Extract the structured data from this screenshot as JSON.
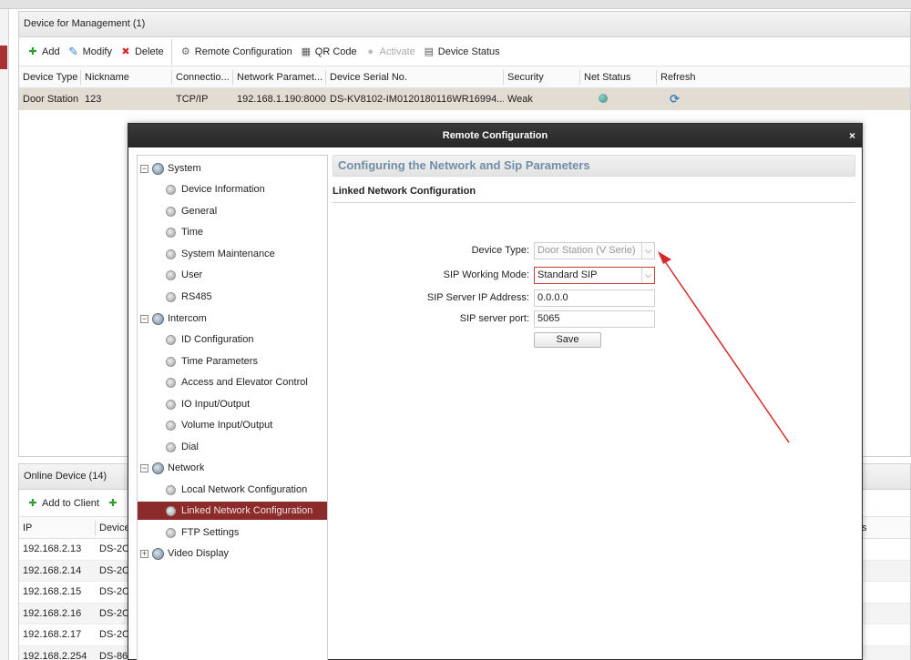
{
  "device_management": {
    "title": "Device for Management (1)",
    "toolbar": [
      {
        "label": "Add",
        "icon": "plus-icon"
      },
      {
        "label": "Modify",
        "icon": "edit-icon"
      },
      {
        "label": "Delete",
        "icon": "delete-icon"
      },
      {
        "label": "Remote Configuration",
        "icon": "gear-icon"
      },
      {
        "label": "QR Code",
        "icon": "qr-code-icon"
      },
      {
        "label": "Activate",
        "icon": "bulb-icon",
        "disabled": true
      },
      {
        "label": "Device Status",
        "icon": "device-status-icon"
      }
    ],
    "columns": [
      "Device Type",
      "Nickname",
      "Connectio...",
      "Network Paramet...",
      "Device Serial No.",
      "Security",
      "Net Status",
      "Refresh"
    ],
    "rows": [
      {
        "device_type": "Door Station",
        "nickname": "123",
        "connection": "TCP/IP",
        "network": "192.168.1.190:8000",
        "serial": "DS-KV8102-IM0120180116WR16994...",
        "security": "Weak"
      }
    ]
  },
  "online_device": {
    "title": "Online Device (14)",
    "add_to_client": "Add to Client",
    "columns": [
      "IP",
      "Device"
    ],
    "rows": [
      {
        "ip": "192.168.2.13",
        "device": "DS-2C"
      },
      {
        "ip": "192.168.2.14",
        "device": "DS-2C"
      },
      {
        "ip": "192.168.2.15",
        "device": "DS-2C"
      },
      {
        "ip": "192.168.2.16",
        "device": "DS-2C"
      },
      {
        "ip": "192.168.2.17",
        "device": "DS-2C"
      },
      {
        "ip": "192.168.2.254",
        "device": "DS-86"
      }
    ],
    "right_fragment": "s"
  },
  "modal": {
    "title": "Remote Configuration",
    "close": "×",
    "tree": {
      "system": {
        "label": "System",
        "items": [
          "Device Information",
          "General",
          "Time",
          "System Maintenance",
          "User",
          "RS485"
        ]
      },
      "intercom": {
        "label": "Intercom",
        "items": [
          "ID Configuration",
          "Time Parameters",
          "Access and Elevator Control",
          "IO Input/Output",
          "Volume Input/Output",
          "Dial"
        ]
      },
      "network": {
        "label": "Network",
        "items": [
          "Local Network Configuration",
          "Linked Network Configuration",
          "FTP Settings"
        ]
      },
      "video": {
        "label": "Video Display"
      }
    },
    "content": {
      "header": "Configuring the Network and Sip Parameters",
      "section": "Linked Network Configuration",
      "device_type_label": "Device Type:",
      "device_type_value": "Door Station (V Serie)",
      "sip_mode_label": "SIP Working Mode:",
      "sip_mode_value": "Standard SIP",
      "sip_ip_label": "SIP Server IP Address:",
      "sip_ip_value": "0.0.0.0",
      "sip_port_label": "SIP server port:",
      "sip_port_value": "5065",
      "save": "Save"
    }
  },
  "colors": {
    "selected_tree_bg": "#8c2b2b",
    "header_text": "#6f8ea8",
    "annotation_arrow": "#d62a2a"
  }
}
